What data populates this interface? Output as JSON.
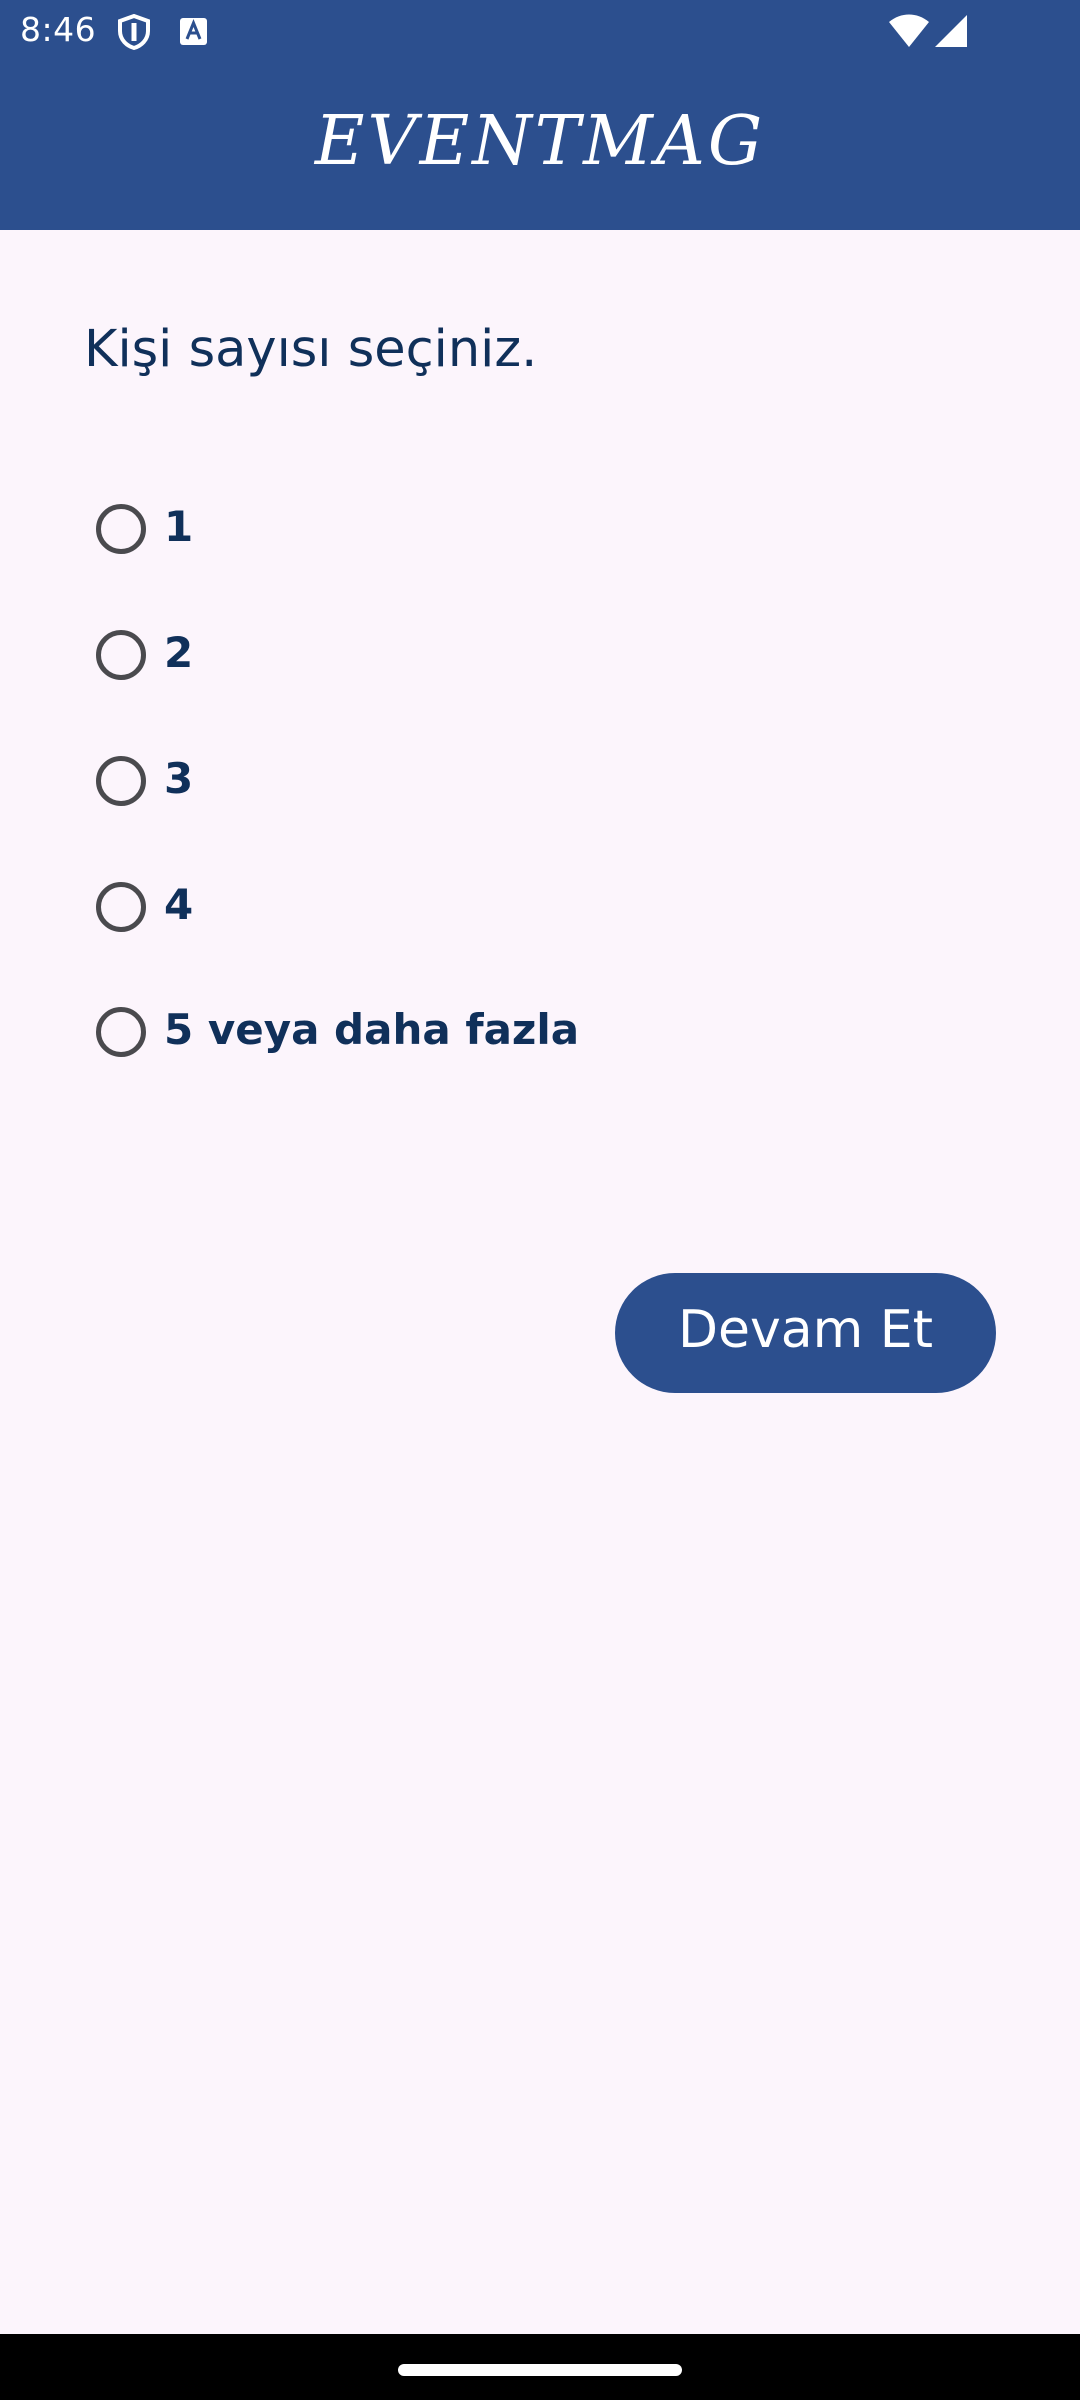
{
  "status_bar": {
    "time": "8:46",
    "icons": [
      "shield-icon",
      "a-notification-icon",
      "wifi-icon",
      "signal-icon"
    ]
  },
  "app_bar": {
    "title": "EVENTMAG",
    "color": "#2C4F8E"
  },
  "question": "Kişi sayısı seçiniz.",
  "options": [
    {
      "label": "1",
      "selected": false
    },
    {
      "label": "2",
      "selected": false
    },
    {
      "label": "3",
      "selected": false
    },
    {
      "label": "4",
      "selected": false
    },
    {
      "label": "5 veya daha fazla",
      "selected": false
    }
  ],
  "continue_button": {
    "label": "Devam Et"
  },
  "colors": {
    "primary": "#2C4F8E",
    "text": "#10305A",
    "background": "#FCF5FC"
  }
}
